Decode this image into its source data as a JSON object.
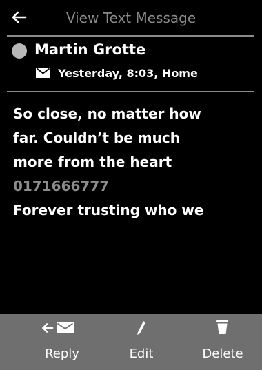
{
  "header": {
    "title": "View Text Message",
    "back_icon": "back-arrow-icon"
  },
  "message": {
    "contact_status_icon": "status-dot-icon",
    "contact_name": "Martin Grotte",
    "meta_icon": "envelope-icon",
    "meta": "Yesterday, 8:03, Home",
    "lines": [
      "So close, no matter how",
      "far. Couldn’t be much",
      "more from the heart",
      "0171666777",
      "Forever trusting who we"
    ]
  },
  "softkeys": [
    {
      "label": "Reply",
      "icon": "reply-envelope-icon"
    },
    {
      "label": "Edit",
      "icon": "pencil-icon"
    },
    {
      "label": "Delete",
      "icon": "trash-icon"
    }
  ],
  "colors": {
    "background": "#000000",
    "title_text": "#8a8a8a",
    "divider": "#8a8a8a",
    "number_text": "#8c8c8c",
    "softkey_bar": "#6f6f6f"
  }
}
